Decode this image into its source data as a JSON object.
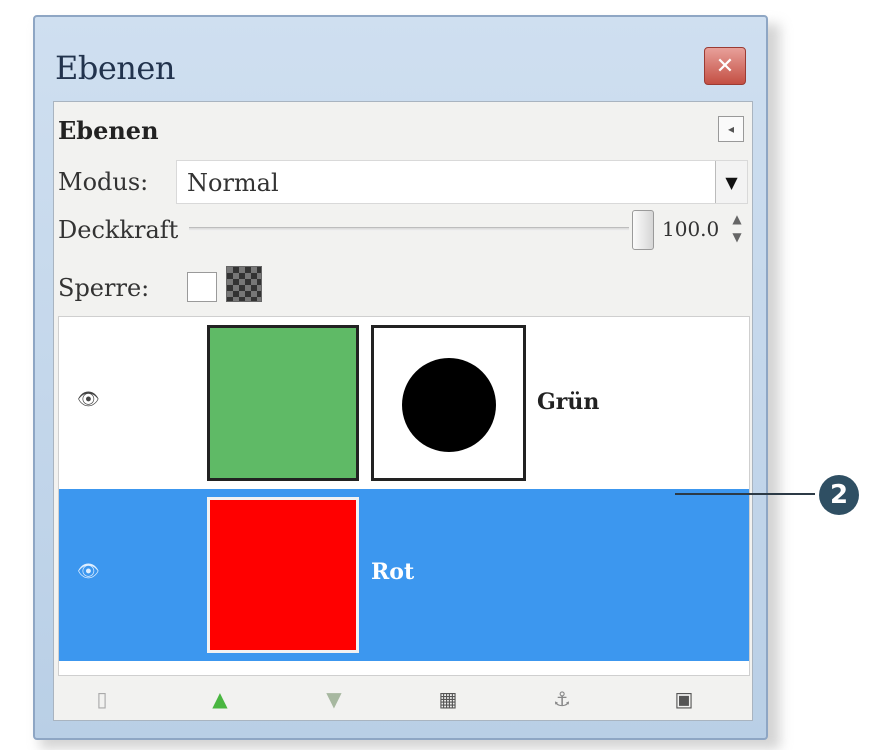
{
  "window": {
    "title": "Ebenen",
    "close_icon": "close-icon"
  },
  "dock": {
    "title": "Ebenen",
    "menu_icon": "dock-menu-icon"
  },
  "mode": {
    "label": "Modus:",
    "value": "Normal"
  },
  "opacity": {
    "label": "Deckkraft",
    "value": "100.0",
    "level_percent": 100
  },
  "lock": {
    "label": "Sperre:",
    "pixels_locked": false,
    "alpha_icon": "lock-alpha-icon"
  },
  "layers": [
    {
      "name": "Grün",
      "visible": true,
      "selected": false,
      "thumb_color": "#5fba66",
      "has_mask": true
    },
    {
      "name": "Rot",
      "visible": true,
      "selected": true,
      "thumb_color": "#ff0000",
      "has_mask": false
    }
  ],
  "toolbar": {
    "icons": [
      "new-layer-icon",
      "raise-layer-icon",
      "lower-layer-icon",
      "duplicate-layer-icon",
      "anchor-layer-icon",
      "delete-layer-icon"
    ]
  },
  "callout": {
    "number": "2"
  },
  "colors": {
    "selection": "#3c97ef",
    "callout": "#2f4f63"
  }
}
